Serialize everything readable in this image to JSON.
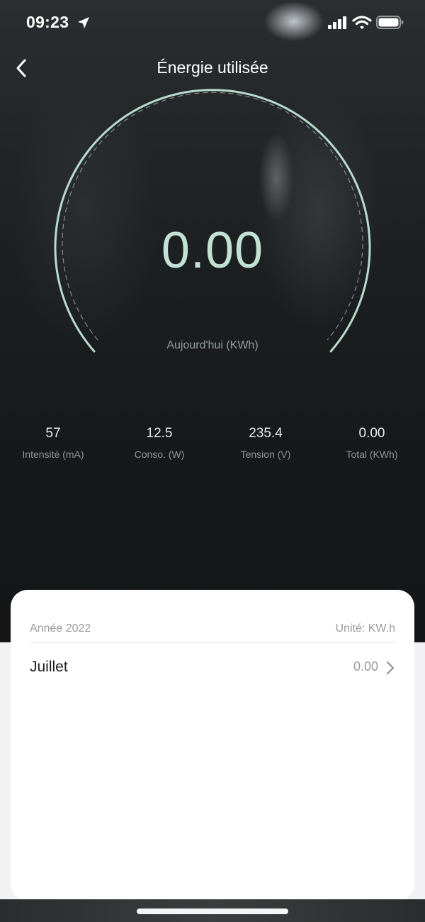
{
  "status_bar": {
    "time": "09:23"
  },
  "header": {
    "title": "Énergie utilisée"
  },
  "gauge": {
    "value": "0.00",
    "label": "Aujourd'hui (KWh)"
  },
  "stats": [
    {
      "value": "57",
      "label": "Intensité (mA)"
    },
    {
      "value": "12.5",
      "label": "Conso. (W)"
    },
    {
      "value": "235.4",
      "label": "Tension (V)"
    },
    {
      "value": "0.00",
      "label": "Total (KWh)"
    }
  ],
  "card": {
    "year": "Année 2022",
    "unit": "Unité: KW.h",
    "rows": [
      {
        "month": "Juillet",
        "value": "0.00"
      }
    ]
  },
  "colors": {
    "accent": "#c2e3d4",
    "card_bg": "#ffffff",
    "text_muted": "#9a9a9a"
  },
  "icons": [
    "location-arrow-icon",
    "signal-icon",
    "wifi-icon",
    "battery-icon",
    "back-chevron-icon",
    "chevron-right-icon"
  ]
}
